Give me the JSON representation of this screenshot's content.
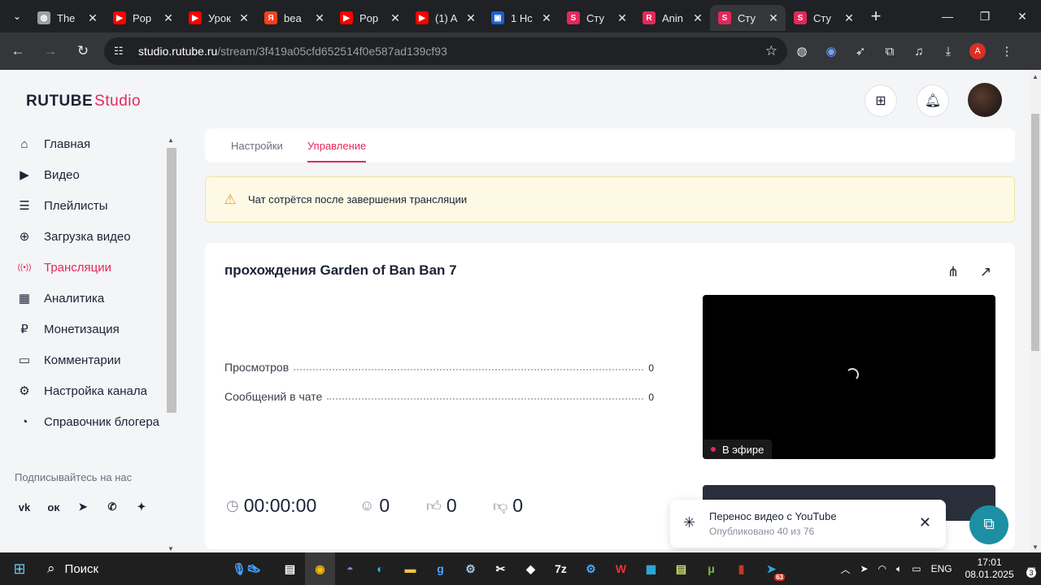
{
  "browser": {
    "tabs": [
      {
        "title": "The",
        "color": "#9aa0a6",
        "glyph": "◍"
      },
      {
        "title": "Pop",
        "color": "#ff0000",
        "glyph": "▶"
      },
      {
        "title": "Урок",
        "color": "#ff0000",
        "glyph": "▶"
      },
      {
        "title": "bea",
        "color": "#fc3f1d",
        "glyph": "Я"
      },
      {
        "title": "Pop",
        "color": "#ff0000",
        "glyph": "▶"
      },
      {
        "title": "(1) A",
        "color": "#ff0000",
        "glyph": "▶"
      },
      {
        "title": "1 Hc",
        "color": "#1a5fd6",
        "glyph": "▣"
      },
      {
        "title": "Сту",
        "color": "#e3285b",
        "glyph": "S"
      },
      {
        "title": "Anin",
        "color": "#e3285b",
        "glyph": "R"
      },
      {
        "title": "Сту",
        "color": "#e3285b",
        "glyph": "S"
      },
      {
        "title": "Сту",
        "color": "#e3285b",
        "glyph": "S"
      }
    ],
    "active_tab": 9,
    "url_host": "studio.rutube.ru",
    "url_path": "/stream/3f419a05cfd652514f0e587ad139cf93",
    "profile_letter": "A"
  },
  "app": {
    "logo_main": "RUTUBE",
    "logo_studio": "Studio"
  },
  "sidebar": {
    "items": [
      {
        "label": "Главная",
        "icon": "home-icon",
        "glyph": "⌂"
      },
      {
        "label": "Видео",
        "icon": "video-icon",
        "glyph": "▶"
      },
      {
        "label": "Плейлисты",
        "icon": "playlist-icon",
        "glyph": "☰"
      },
      {
        "label": "Загрузка видео",
        "icon": "upload-icon",
        "glyph": "⊕"
      },
      {
        "label": "Трансляции",
        "icon": "broadcast-icon",
        "glyph": "((•))"
      },
      {
        "label": "Аналитика",
        "icon": "analytics-icon",
        "glyph": "▦"
      },
      {
        "label": "Монетизация",
        "icon": "monetization-icon",
        "glyph": "₽"
      },
      {
        "label": "Комментарии",
        "icon": "comments-icon",
        "glyph": "▭"
      },
      {
        "label": "Настройка канала",
        "icon": "settings-gear-icon",
        "glyph": "⚙"
      },
      {
        "label": "Справочник блогера",
        "icon": "handbook-icon",
        "glyph": "◔"
      }
    ],
    "active_index": 4,
    "follow_label": "Подписывайтесь на нас",
    "socials": [
      {
        "name": "vk-icon",
        "glyph": "vk"
      },
      {
        "name": "odnoklassniki-icon",
        "glyph": "ᴏᴋ"
      },
      {
        "name": "telegram-icon",
        "glyph": "➤"
      },
      {
        "name": "viber-icon",
        "glyph": "✆"
      },
      {
        "name": "dzen-icon",
        "glyph": "✦"
      }
    ]
  },
  "page_tabs": {
    "settings": "Настройки",
    "manage": "Управление"
  },
  "alert": {
    "text": "Чат сотрётся после завершения трансляции"
  },
  "stream": {
    "title": "прохождения Garden of Ban Ban 7",
    "views_label": "Просмотров",
    "views_value": "0",
    "chat_label": "Сообщений в чате",
    "chat_value": "0",
    "live_label": "В эфире",
    "duration": "00:00:00",
    "viewers": "0",
    "likes": "0",
    "dislikes": "0"
  },
  "toast": {
    "title": "Перенос видео с YouTube",
    "subtitle": "Опубликовано 40 из 76"
  },
  "taskbar": {
    "search_label": "Поиск",
    "lang": "ENG",
    "time": "17:01",
    "date": "08.01.2025",
    "notif_count": "3",
    "tray_badge": "63"
  },
  "colors": {
    "accent": "#e3285b",
    "warning_bg": "#fdf9e4"
  }
}
